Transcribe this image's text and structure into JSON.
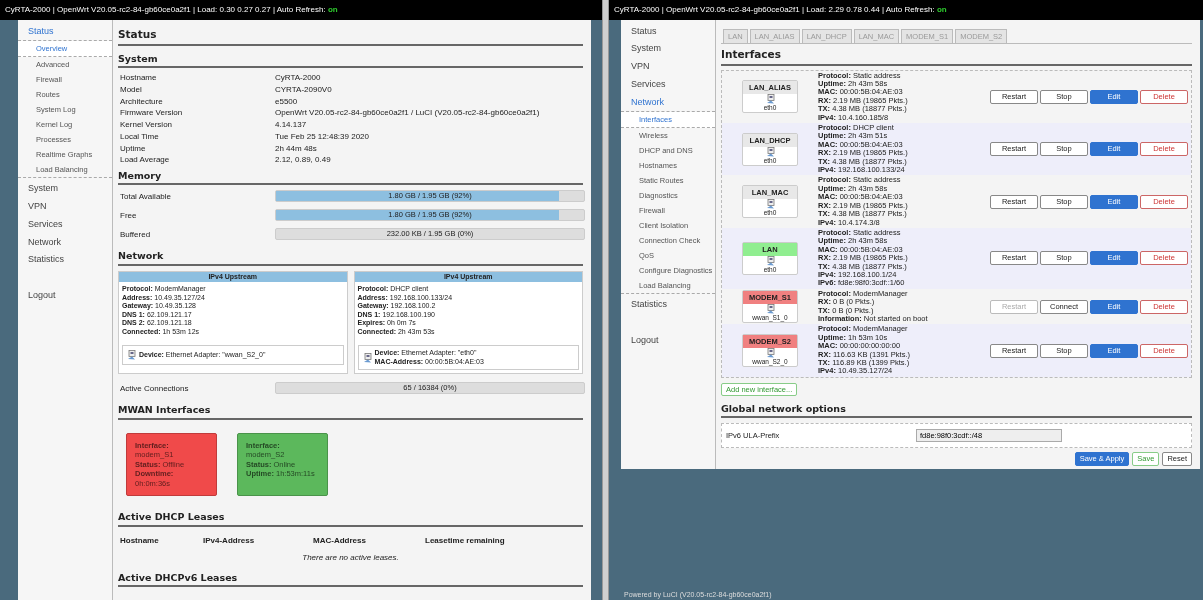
{
  "left": {
    "header": {
      "text": "CyRTA-2000 | OpenWrt V20.05-rc2-84-gb60ce0a2f1 | Load: 0.30 0.27 0.27 | Auto Refresh:",
      "refresh": "on"
    },
    "sidebar": [
      {
        "label": "Status",
        "selected": true,
        "children": [
          {
            "label": "Overview",
            "selected": true
          },
          {
            "label": "Advanced",
            "selected": false
          },
          {
            "label": "Firewall",
            "selected": false
          },
          {
            "label": "Routes",
            "selected": false
          },
          {
            "label": "System Log",
            "selected": false
          },
          {
            "label": "Kernel Log",
            "selected": false
          },
          {
            "label": "Processes",
            "selected": false
          },
          {
            "label": "Realtime Graphs",
            "selected": false
          },
          {
            "label": "Load Balancing",
            "selected": false
          }
        ]
      },
      {
        "label": "System",
        "selected": false
      },
      {
        "label": "VPN",
        "selected": false
      },
      {
        "label": "Services",
        "selected": false
      },
      {
        "label": "Network",
        "selected": false
      },
      {
        "label": "Statistics",
        "selected": false
      }
    ],
    "logout": "Logout",
    "title": "Status",
    "system": {
      "heading": "System",
      "rows": [
        {
          "label": "Hostname",
          "value": "CyRTA-2000"
        },
        {
          "label": "Model",
          "value": "CYRTA-2090V0"
        },
        {
          "label": "Architecture",
          "value": "e5500"
        },
        {
          "label": "Firmware Version",
          "value": "OpenWrt V20.05-rc2-84-gb60ce0a2f1 / LuCI (V20.05-rc2-84-gb60ce0a2f1)"
        },
        {
          "label": "Kernel Version",
          "value": "4.14.137"
        },
        {
          "label": "Local Time",
          "value": "Tue Feb 25 12:48:39 2020"
        },
        {
          "label": "Uptime",
          "value": "2h 44m 48s"
        },
        {
          "label": "Load Average",
          "value": "2.12, 0.89, 0.49"
        }
      ]
    },
    "memory": {
      "heading": "Memory",
      "bars": [
        {
          "label": "Total Available",
          "level": 0.92,
          "reading": "1.80 GB / 1.95 GB (92%)"
        },
        {
          "label": "Free",
          "level": 0.92,
          "reading": "1.80 GB / 1.95 GB (92%)"
        },
        {
          "label": "Buffered",
          "level": 0,
          "reading": "232.00 KB / 1.95 GB (0%)"
        }
      ]
    },
    "network": {
      "heading": "Network",
      "upstreams": [
        {
          "title": "IPv4 Upstream",
          "fields": [
            {
              "key": "Protocol:",
              "value": "ModemManager"
            },
            {
              "key": "Address:",
              "value": "10.49.35.127/24"
            },
            {
              "key": "Gateway:",
              "value": "10.49.35.128"
            },
            {
              "key": "DNS 1:",
              "value": "62.109.121.17"
            },
            {
              "key": "DNS 2:",
              "value": "62.109.121.18"
            },
            {
              "key": "Connected:",
              "value": "1h 53m 12s"
            }
          ],
          "device": [
            {
              "key": "Device:",
              "value": "Ethernet Adapter: \"wwan_S2_0\""
            }
          ]
        },
        {
          "title": "IPv4 Upstream",
          "fields": [
            {
              "key": "Protocol:",
              "value": "DHCP client"
            },
            {
              "key": "Address:",
              "value": "192.168.100.133/24"
            },
            {
              "key": "Gateway:",
              "value": "192.168.100.2"
            },
            {
              "key": "DNS 1:",
              "value": "192.168.100.190"
            },
            {
              "key": "Expires:",
              "value": "0h 0m 7s"
            },
            {
              "key": "Connected:",
              "value": "2h 43m 53s"
            }
          ],
          "device": [
            {
              "key": "Device:",
              "value": "Ethernet Adapter: \"eth0\""
            },
            {
              "key": "MAC-Address:",
              "value": "00:00:5B:04:AE:03"
            }
          ]
        }
      ],
      "connections": {
        "label": "Active Connections",
        "level": 0,
        "reading": "65 / 16384 (0%)"
      }
    },
    "mwan": {
      "heading": "MWAN Interfaces",
      "cards": [
        {
          "color": "#f04a4a",
          "fields": [
            {
              "key": "Interface:",
              "value": "modem_S1"
            },
            {
              "key": "Status:",
              "value": "Offline"
            },
            {
              "key": "Downtime:",
              "value": "0h:0m:36s"
            }
          ]
        },
        {
          "color": "#5cb85c",
          "fields": [
            {
              "key": "Interface:",
              "value": "modem_S2"
            },
            {
              "key": "Status:",
              "value": "Online"
            },
            {
              "key": "Uptime:",
              "value": "1h:53m:11s"
            }
          ]
        }
      ]
    },
    "dhcp": {
      "heading": "Active DHCP Leases",
      "columns": [
        "Hostname",
        "IPv4-Address",
        "MAC-Address",
        "Leasetime remaining"
      ],
      "empty": "There are no active leases."
    },
    "dhcp6": {
      "heading": "Active DHCPv6 Leases"
    }
  },
  "right": {
    "header": {
      "text": "CyRTA-2000 | OpenWrt V20.05-rc2-84-gb60ce0a2f1 | Load: 2.29 0.78 0.44 | Auto Refresh:",
      "refresh": "on"
    },
    "sidebar": [
      {
        "label": "Status",
        "selected": false
      },
      {
        "label": "System",
        "selected": false
      },
      {
        "label": "VPN",
        "selected": false
      },
      {
        "label": "Services",
        "selected": false
      },
      {
        "label": "Network",
        "selected": true,
        "children": [
          {
            "label": "Interfaces",
            "selected": true
          },
          {
            "label": "Wireless",
            "selected": false
          },
          {
            "label": "DHCP and DNS",
            "selected": false
          },
          {
            "label": "Hostnames",
            "selected": false
          },
          {
            "label": "Static Routes",
            "selected": false
          },
          {
            "label": "Diagnostics",
            "selected": false
          },
          {
            "label": "Firewall",
            "selected": false
          },
          {
            "label": "Client Isolation",
            "selected": false
          },
          {
            "label": "Connection Check",
            "selected": false
          },
          {
            "label": "QoS",
            "selected": false
          },
          {
            "label": "Configure Diagnostics",
            "selected": false
          },
          {
            "label": "Load Balancing",
            "selected": false
          }
        ]
      },
      {
        "label": "Statistics",
        "selected": false
      }
    ],
    "logout": "Logout",
    "tabs": [
      {
        "label": "LAN",
        "selected": false
      },
      {
        "label": "LAN_ALIAS",
        "selected": false
      },
      {
        "label": "LAN_DHCP",
        "selected": false
      },
      {
        "label": "LAN_MAC",
        "selected": false
      },
      {
        "label": "MODEM_S1",
        "selected": false
      },
      {
        "label": "MODEM_S2",
        "selected": false
      }
    ],
    "title": "Interfaces",
    "interfaces": [
      {
        "name": "LAN_ALIAS",
        "color": "#e8e8e8",
        "device": "eth0",
        "fields": [
          {
            "key": "Protocol:",
            "value": "Static address"
          },
          {
            "key": "Uptime:",
            "value": "2h 43m 58s"
          },
          {
            "key": "MAC:",
            "value": "00:00:5B:04:AE:03"
          },
          {
            "key": "RX:",
            "value": "2.19 MB (19865 Pkts.)"
          },
          {
            "key": "TX:",
            "value": "4.38 MB (18877 Pkts.)"
          },
          {
            "key": "IPv4:",
            "value": "10.4.160.185/8"
          }
        ],
        "buttons": [
          {
            "label": "Restart",
            "kind": "default",
            "disabled": false
          },
          {
            "label": "Stop",
            "kind": "default",
            "disabled": false
          },
          {
            "label": "Edit",
            "kind": "primary",
            "disabled": false
          },
          {
            "label": "Delete",
            "kind": "danger",
            "disabled": false
          }
        ]
      },
      {
        "name": "LAN_DHCP",
        "color": "#e8e8e8",
        "device": "eth0",
        "fields": [
          {
            "key": "Protocol:",
            "value": "DHCP client"
          },
          {
            "key": "Uptime:",
            "value": "2h 43m 51s"
          },
          {
            "key": "MAC:",
            "value": "00:00:5B:04:AE:03"
          },
          {
            "key": "RX:",
            "value": "2.19 MB (19865 Pkts.)"
          },
          {
            "key": "TX:",
            "value": "4.38 MB (18877 Pkts.)"
          },
          {
            "key": "IPv4:",
            "value": "192.168.100.133/24"
          }
        ],
        "buttons": [
          {
            "label": "Restart",
            "kind": "default",
            "disabled": false
          },
          {
            "label": "Stop",
            "kind": "default",
            "disabled": false
          },
          {
            "label": "Edit",
            "kind": "primary",
            "disabled": false
          },
          {
            "label": "Delete",
            "kind": "danger",
            "disabled": false
          }
        ]
      },
      {
        "name": "LAN_MAC",
        "color": "#e8e8e8",
        "device": "eth0",
        "fields": [
          {
            "key": "Protocol:",
            "value": "Static address"
          },
          {
            "key": "Uptime:",
            "value": "2h 43m 58s"
          },
          {
            "key": "MAC:",
            "value": "00:00:5B:04:AE:03"
          },
          {
            "key": "RX:",
            "value": "2.19 MB (19865 Pkts.)"
          },
          {
            "key": "TX:",
            "value": "4.38 MB (18877 Pkts.)"
          },
          {
            "key": "IPv4:",
            "value": "10.4.174.3/8"
          }
        ],
        "buttons": [
          {
            "label": "Restart",
            "kind": "default",
            "disabled": false
          },
          {
            "label": "Stop",
            "kind": "default",
            "disabled": false
          },
          {
            "label": "Edit",
            "kind": "primary",
            "disabled": false
          },
          {
            "label": "Delete",
            "kind": "danger",
            "disabled": false
          }
        ]
      },
      {
        "name": "LAN",
        "color": "#90ee90",
        "device": "eth0",
        "fields": [
          {
            "key": "Protocol:",
            "value": "Static address"
          },
          {
            "key": "Uptime:",
            "value": "2h 43m 58s"
          },
          {
            "key": "MAC:",
            "value": "00:00:5B:04:AE:03"
          },
          {
            "key": "RX:",
            "value": "2.19 MB (19865 Pkts.)"
          },
          {
            "key": "TX:",
            "value": "4.38 MB (18877 Pkts.)"
          },
          {
            "key": "IPv4:",
            "value": "192.168.100.1/24"
          },
          {
            "key": "IPv6:",
            "value": "fd8e:98f0:3cdf::1/60"
          }
        ],
        "buttons": [
          {
            "label": "Restart",
            "kind": "default",
            "disabled": false
          },
          {
            "label": "Stop",
            "kind": "default",
            "disabled": false
          },
          {
            "label": "Edit",
            "kind": "primary",
            "disabled": false
          },
          {
            "label": "Delete",
            "kind": "danger",
            "disabled": false
          }
        ]
      },
      {
        "name": "MODEM_S1",
        "color": "#f08080",
        "device": "wwan_S1_0",
        "fields": [
          {
            "key": "Protocol:",
            "value": "ModemManager"
          },
          {
            "key": "RX:",
            "value": "0 B (0 Pkts.)"
          },
          {
            "key": "TX:",
            "value": "0 B (0 Pkts.)"
          },
          {
            "key": "Information:",
            "value": "Not started on boot"
          }
        ],
        "buttons": [
          {
            "label": "Restart",
            "kind": "default",
            "disabled": true
          },
          {
            "label": "Connect",
            "kind": "default",
            "disabled": false
          },
          {
            "label": "Edit",
            "kind": "primary",
            "disabled": false
          },
          {
            "label": "Delete",
            "kind": "danger",
            "disabled": false
          }
        ]
      },
      {
        "name": "MODEM_S2",
        "color": "#f08080",
        "device": "wwan_S2_0",
        "fields": [
          {
            "key": "Protocol:",
            "value": "ModemManager"
          },
          {
            "key": "Uptime:",
            "value": "1h 53m 10s"
          },
          {
            "key": "MAC:",
            "value": "00:00:00:00:00:00"
          },
          {
            "key": "RX:",
            "value": "116.63 KB (1391 Pkts.)"
          },
          {
            "key": "TX:",
            "value": "116.89 KB (1399 Pkts.)"
          },
          {
            "key": "IPv4:",
            "value": "10.49.35.127/24"
          }
        ],
        "buttons": [
          {
            "label": "Restart",
            "kind": "default",
            "disabled": false
          },
          {
            "label": "Stop",
            "kind": "default",
            "disabled": false
          },
          {
            "label": "Edit",
            "kind": "primary",
            "disabled": false
          },
          {
            "label": "Delete",
            "kind": "danger",
            "disabled": false
          }
        ]
      }
    ],
    "add_button": "Add new interface...",
    "global": {
      "heading": "Global network options",
      "fields": [
        {
          "label": "IPv6 ULA-Prefix",
          "value": "fd8e:98f0:3cdf::/48"
        }
      ]
    },
    "actions": [
      {
        "label": "Save & Apply",
        "kind": "primary"
      },
      {
        "label": "Save",
        "kind": "positive"
      },
      {
        "label": "Reset",
        "kind": "default"
      }
    ],
    "footer": "Powered by LuCI (V20.05-rc2-84-gb60ce0a2f1)"
  }
}
